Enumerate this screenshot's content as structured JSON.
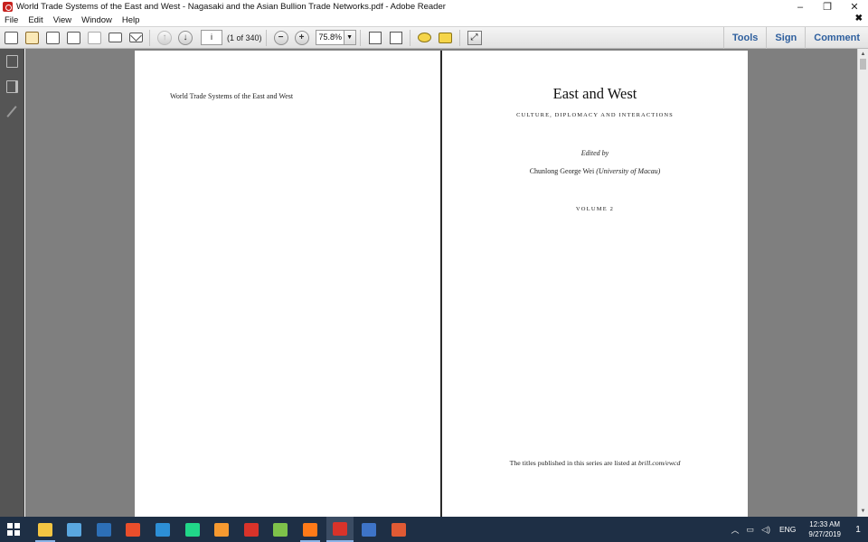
{
  "window": {
    "title": "World Trade Systems of the East and West - Nagasaki and the Asian Bullion Trade Networks.pdf - Adobe Reader",
    "minimize": "–",
    "maximize": "❐",
    "close": "✕"
  },
  "menu": {
    "items": [
      "File",
      "Edit",
      "View",
      "Window",
      "Help"
    ],
    "close_doc": "✖"
  },
  "toolbar": {
    "page_number": "i",
    "page_count": "(1 of 340)",
    "zoom": "75.8%",
    "zoom_out": "−",
    "zoom_in": "+",
    "prev": "↑",
    "next": "↓",
    "tools": "Tools",
    "sign": "Sign",
    "comment": "Comment"
  },
  "left_page": {
    "running_head": "World Trade Systems of the East and West"
  },
  "right_page": {
    "title": "East and West",
    "subtitle": "CULTURE, DIPLOMACY AND INTERACTIONS",
    "edited_by": "Edited by",
    "editor_name": "Chunlong George Wei",
    "editor_affiliation": "(University of Macau)",
    "volume": "VOLUME 2",
    "series_note_prefix": "The titles published in this series are listed at",
    "series_note_link": "brill.com/ewcd"
  },
  "taskbar": {
    "apps": [
      {
        "icon": "file-explorer-icon",
        "color": "#f4c542"
      },
      {
        "icon": "notes-icon",
        "color": "#5aa7e0"
      },
      {
        "icon": "powershell-icon",
        "color": "#2d6fb6"
      },
      {
        "icon": "shield-app-icon",
        "color": "#e94e2b"
      },
      {
        "icon": "window-app-icon",
        "color": "#2d8fd6"
      },
      {
        "icon": "pycharm-icon",
        "color": "#21d789"
      },
      {
        "icon": "sublime-icon",
        "color": "#f79a30"
      },
      {
        "icon": "acrobat-icon",
        "color": "#d9332a"
      },
      {
        "icon": "notepad-icon",
        "color": "#7ec24a"
      },
      {
        "icon": "firefox-icon",
        "color": "#ff7a18"
      },
      {
        "icon": "adobe-reader-icon",
        "color": "#d9332a"
      },
      {
        "icon": "word-icon",
        "color": "#3e74c8"
      },
      {
        "icon": "presentation-icon",
        "color": "#e05a34"
      }
    ],
    "active_app": 10,
    "lang": "ENG",
    "time": "12:33 AM",
    "date": "9/27/2019",
    "notification_count": "1"
  }
}
